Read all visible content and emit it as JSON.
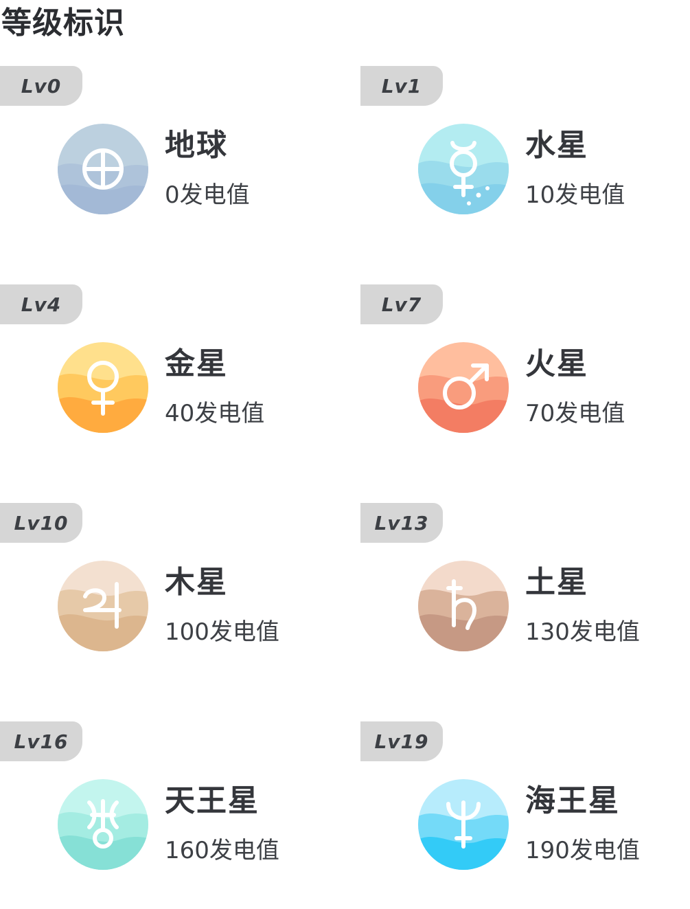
{
  "page": {
    "title": "等级标识"
  },
  "levels": [
    {
      "badge": "Lv0",
      "name": "地球",
      "points": "0发电值",
      "icon": "earth-symbol-icon",
      "colors": {
        "top": "#bcd0df",
        "mid": "#aec3da",
        "bottom": "#a3b9d6"
      }
    },
    {
      "badge": "Lv1",
      "name": "水星",
      "points": "10发电值",
      "icon": "mercury-symbol-icon",
      "colors": {
        "top": "#b3ecf1",
        "mid": "#9adcec",
        "bottom": "#84d0ea"
      }
    },
    {
      "badge": "Lv4",
      "name": "金星",
      "points": "40发电值",
      "icon": "venus-symbol-icon",
      "colors": {
        "top": "#ffe08c",
        "mid": "#ffc95e",
        "bottom": "#ffab3f"
      }
    },
    {
      "badge": "Lv7",
      "name": "火星",
      "points": "70发电值",
      "icon": "mars-symbol-icon",
      "colors": {
        "top": "#ffbe9e",
        "mid": "#f99c7d",
        "bottom": "#f37d63"
      }
    },
    {
      "badge": "Lv10",
      "name": "木星",
      "points": "100发电值",
      "icon": "jupiter-symbol-icon",
      "colors": {
        "top": "#f3e0d0",
        "mid": "#e6c9a8",
        "bottom": "#dcb68e"
      }
    },
    {
      "badge": "Lv13",
      "name": "土星",
      "points": "130发电值",
      "icon": "saturn-symbol-icon",
      "colors": {
        "top": "#f3dacb",
        "mid": "#dab39b",
        "bottom": "#c69984"
      }
    },
    {
      "badge": "Lv16",
      "name": "天王星",
      "points": "160发电值",
      "icon": "uranus-symbol-icon",
      "colors": {
        "top": "#c3f5ee",
        "mid": "#a4ece2",
        "bottom": "#86e0d6"
      }
    },
    {
      "badge": "Lv19",
      "name": "海王星",
      "points": "190发电值",
      "icon": "neptune-symbol-icon",
      "colors": {
        "top": "#b7ecfc",
        "mid": "#74daf8",
        "bottom": "#33cbf7"
      }
    }
  ]
}
